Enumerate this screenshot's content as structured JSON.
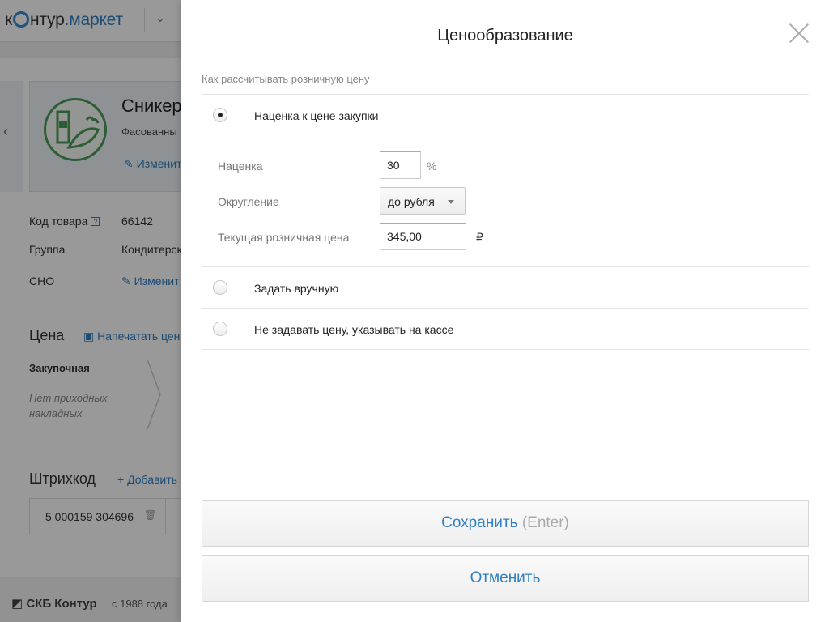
{
  "app": {
    "logo": {
      "k": "к",
      "ntur": "нтур",
      "dot_market": ".маркет"
    }
  },
  "product": {
    "title": "Сникер",
    "subtitle": "Фасованны",
    "edit_label": "Изменит"
  },
  "details": [
    {
      "label": "Код товара",
      "value": "66142"
    },
    {
      "label": "Группа",
      "value": "Кондитерск"
    },
    {
      "label": "СНО",
      "value": "Изменит"
    }
  ],
  "price_section": {
    "title": "Цена",
    "print_link": "Напечатать цен",
    "purchase_title": "Закупочная",
    "purchase_note": "Нет приходных накладных"
  },
  "barcode_section": {
    "title": "Штрихкод",
    "add_link": "Добавить",
    "value": "5 000159 304696"
  },
  "footer": {
    "brand": "СКБ Контур",
    "since": "с 1988 года"
  },
  "modal": {
    "title": "Ценообразование",
    "question": "Как рассчитывать розничную цену",
    "options": [
      {
        "label": "Наценка к цене закупки",
        "checked": true
      },
      {
        "label": "Задать вручную",
        "checked": false
      },
      {
        "label": "Не задавать цену, указывать на кассе",
        "checked": false
      }
    ],
    "fields": {
      "markup": {
        "label": "Наценка",
        "value": "30",
        "unit": "%"
      },
      "rounding": {
        "label": "Округление",
        "value": "до рубля"
      },
      "current_price": {
        "label": "Текущая розничная цена",
        "value": "345,00",
        "unit": "₽"
      }
    },
    "save_button": {
      "label": "Сохранить",
      "hint": "(Enter)"
    },
    "cancel_button": {
      "label": "Отменить"
    }
  },
  "icons": {
    "close": "close-icon",
    "caret": "chevron-down-icon",
    "product": "grocery-icon",
    "pencil": "pencil-icon",
    "printer": "printer-icon",
    "trash": "trash-icon"
  },
  "colors": {
    "link": "#2f7fc2",
    "overlay": "rgba(0,0,0,0.4)",
    "product_icon": "#4a9b5a"
  }
}
